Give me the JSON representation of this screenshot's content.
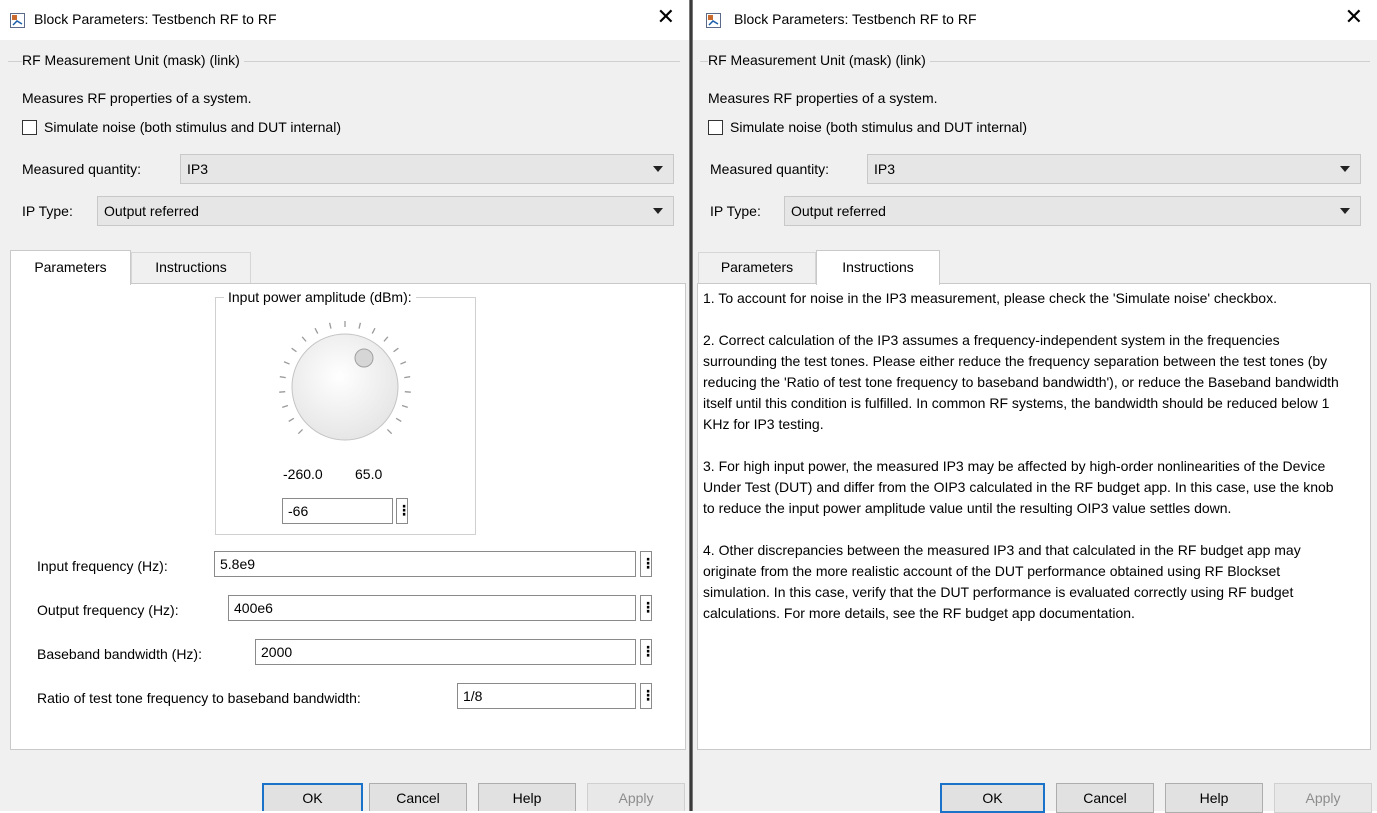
{
  "window_title": "Block Parameters: Testbench RF to RF",
  "group_title": "RF Measurement Unit (mask) (link)",
  "description": "Measures RF properties of a system.",
  "simulate_noise_label": "Simulate noise (both stimulus and DUT internal)",
  "simulate_noise_checked": false,
  "measured_quantity": {
    "label": "Measured quantity:",
    "value": "IP3"
  },
  "ip_type": {
    "label": "IP Type:",
    "value": "Output referred"
  },
  "tabs": {
    "parameters": "Parameters",
    "instructions": "Instructions"
  },
  "left_active_tab": "Parameters",
  "right_active_tab": "Instructions",
  "parameters": {
    "knob_title": "Input power amplitude (dBm):",
    "knob_min": "-260.0",
    "knob_max": "65.0",
    "knob_value": "-66",
    "input_frequency": {
      "label": "Input frequency (Hz):",
      "value": "5.8e9"
    },
    "output_frequency": {
      "label": "Output frequency (Hz):",
      "value": "400e6"
    },
    "baseband_bandwidth": {
      "label": "Baseband bandwidth (Hz):",
      "value": "2000"
    },
    "ratio": {
      "label": "Ratio of test tone frequency to baseband bandwidth:",
      "value": "1/8"
    }
  },
  "instructions": [
    "1. To account for noise in the IP3 measurement, please check the 'Simulate noise' checkbox.",
    "2. Correct calculation of the IP3 assumes a frequency-independent system in the frequencies surrounding the test tones. Please either reduce the frequency separation between the test tones (by reducing the 'Ratio of test tone frequency to baseband bandwidth'), or reduce the Baseband bandwidth itself until this condition is fulfilled. In common RF systems, the bandwidth should be reduced below 1 KHz for IP3 testing.",
    "3. For high input power, the measured IP3 may be affected by high-order nonlinearities of the Device Under Test (DUT) and differ from the OIP3 calculated in the RF budget app. In this case, use the knob to reduce the input power amplitude value until the resulting OIP3 value settles down.",
    "4. Other discrepancies between the measured IP3 and that calculated in the RF budget app may originate from the more realistic account of the DUT performance obtained using RF Blockset simulation. In this case, verify that the DUT performance is evaluated correctly using RF budget calculations. For more details, see the RF budget app documentation."
  ],
  "buttons": {
    "ok": "OK",
    "cancel": "Cancel",
    "help": "Help",
    "apply": "Apply"
  },
  "icons": {
    "app": "simulink-block-icon",
    "close": "close-icon",
    "dropdown": "chevron-down-icon",
    "more": "vertical-ellipsis-icon"
  },
  "colors": {
    "dialog_bg": "#f0f0f0",
    "default_button_border": "#1a73c8",
    "disabled_text": "#8d8d8d"
  }
}
